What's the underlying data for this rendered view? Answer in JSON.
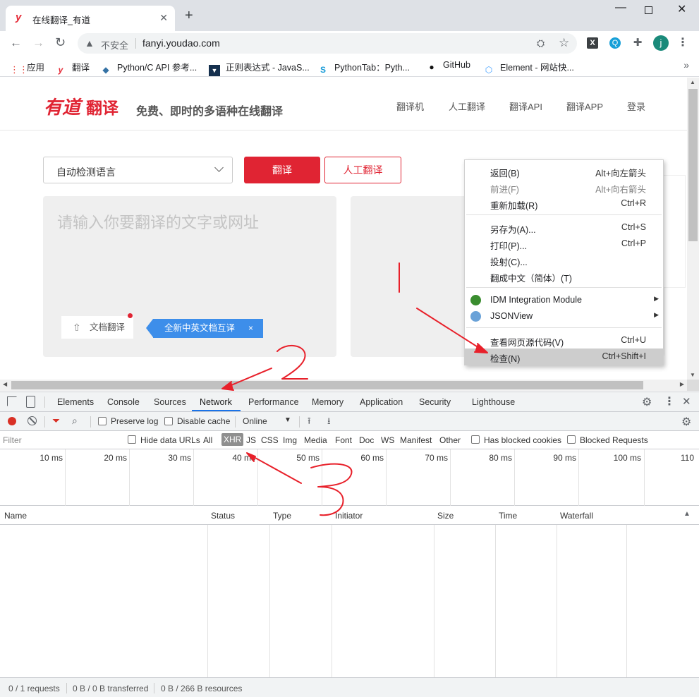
{
  "browser": {
    "tab_title": "在线翻译_有道",
    "tab_favicon": "y",
    "omnibox": {
      "security_label": "不安全",
      "url": "fanyi.youdao.com"
    },
    "avatar_letter": "j",
    "bookmarks": [
      {
        "label": "应用",
        "icon": "apps-grid-icon"
      },
      {
        "label": "翻译",
        "icon": "youdao-icon"
      },
      {
        "label": "Python/C API 参考...",
        "icon": "python-icon"
      },
      {
        "label": "正则表达式 - JavaS...",
        "icon": "bookmark-icon"
      },
      {
        "label": "PythonTab：Pyth...",
        "icon": "pythontab-icon"
      },
      {
        "label": "GitHub",
        "icon": "github-icon"
      },
      {
        "label": "Element - 网站快...",
        "icon": "element-icon"
      }
    ],
    "bookmarks_overflow": "»"
  },
  "page": {
    "logo_mark": "有道",
    "logo_text": "翻译",
    "slogan": "免费、即时的多语种在线翻译",
    "nav": [
      "翻译机",
      "人工翻译",
      "翻译API",
      "翻译APP",
      "登录"
    ],
    "lang_select": "自动检测语言",
    "translate_button": "翻译",
    "human_button": "人工翻译",
    "source_placeholder": "请输入你要翻译的文字或网址",
    "doc_button": "文档翻译",
    "promo_label": "全新中英文档互译",
    "promo_close": "×"
  },
  "context_menu": {
    "items": [
      {
        "label": "返回(B)",
        "shortcut": "Alt+向左箭头"
      },
      {
        "label": "前进(F)",
        "shortcut": "Alt+向右箭头",
        "disabled": true
      },
      {
        "label": "重新加载(R)",
        "shortcut": "Ctrl+R"
      },
      {
        "label": "另存为(A)...",
        "shortcut": "Ctrl+S"
      },
      {
        "label": "打印(P)...",
        "shortcut": "Ctrl+P"
      },
      {
        "label": "投射(C)...",
        "shortcut": ""
      },
      {
        "label": "翻成中文（简体）(T)",
        "shortcut": ""
      },
      {
        "label": "IDM Integration Module",
        "shortcut": "",
        "submenu": true,
        "icon": "idm-icon"
      },
      {
        "label": "JSONView",
        "shortcut": "",
        "submenu": true,
        "icon": "jsonview-icon"
      },
      {
        "label": "查看网页源代码(V)",
        "shortcut": "Ctrl+U"
      },
      {
        "label": "检查(N)",
        "shortcut": "Ctrl+Shift+I",
        "highlighted": true
      }
    ]
  },
  "devtools": {
    "tabs": [
      "Elements",
      "Console",
      "Sources",
      "Network",
      "Performance",
      "Memory",
      "Application",
      "Security",
      "Lighthouse"
    ],
    "active_tab": "Network",
    "preserve_log": "Preserve log",
    "disable_cache": "Disable cache",
    "throttle": "Online",
    "filter_placeholder": "Filter",
    "hide_data_urls": "Hide data URLs",
    "filter_types": [
      "All",
      "XHR",
      "JS",
      "CSS",
      "Img",
      "Media",
      "Font",
      "Doc",
      "WS",
      "Manifest",
      "Other"
    ],
    "active_filter": "XHR",
    "has_blocked_cookies": "Has blocked cookies",
    "blocked_requests": "Blocked Requests",
    "timeline_ticks": [
      "10 ms",
      "20 ms",
      "30 ms",
      "40 ms",
      "50 ms",
      "60 ms",
      "70 ms",
      "80 ms",
      "90 ms",
      "100 ms",
      "110"
    ],
    "columns": [
      "Name",
      "Status",
      "Type",
      "Initiator",
      "Size",
      "Time",
      "Waterfall"
    ],
    "status": {
      "requests": "0 / 1 requests",
      "transferred": "0 B / 0 B transferred",
      "resources": "0 B / 266 B resources"
    }
  },
  "colors": {
    "brand_red": "#e02433",
    "devtools_active": "#1a73e8",
    "annotation_red": "#e8202a"
  }
}
